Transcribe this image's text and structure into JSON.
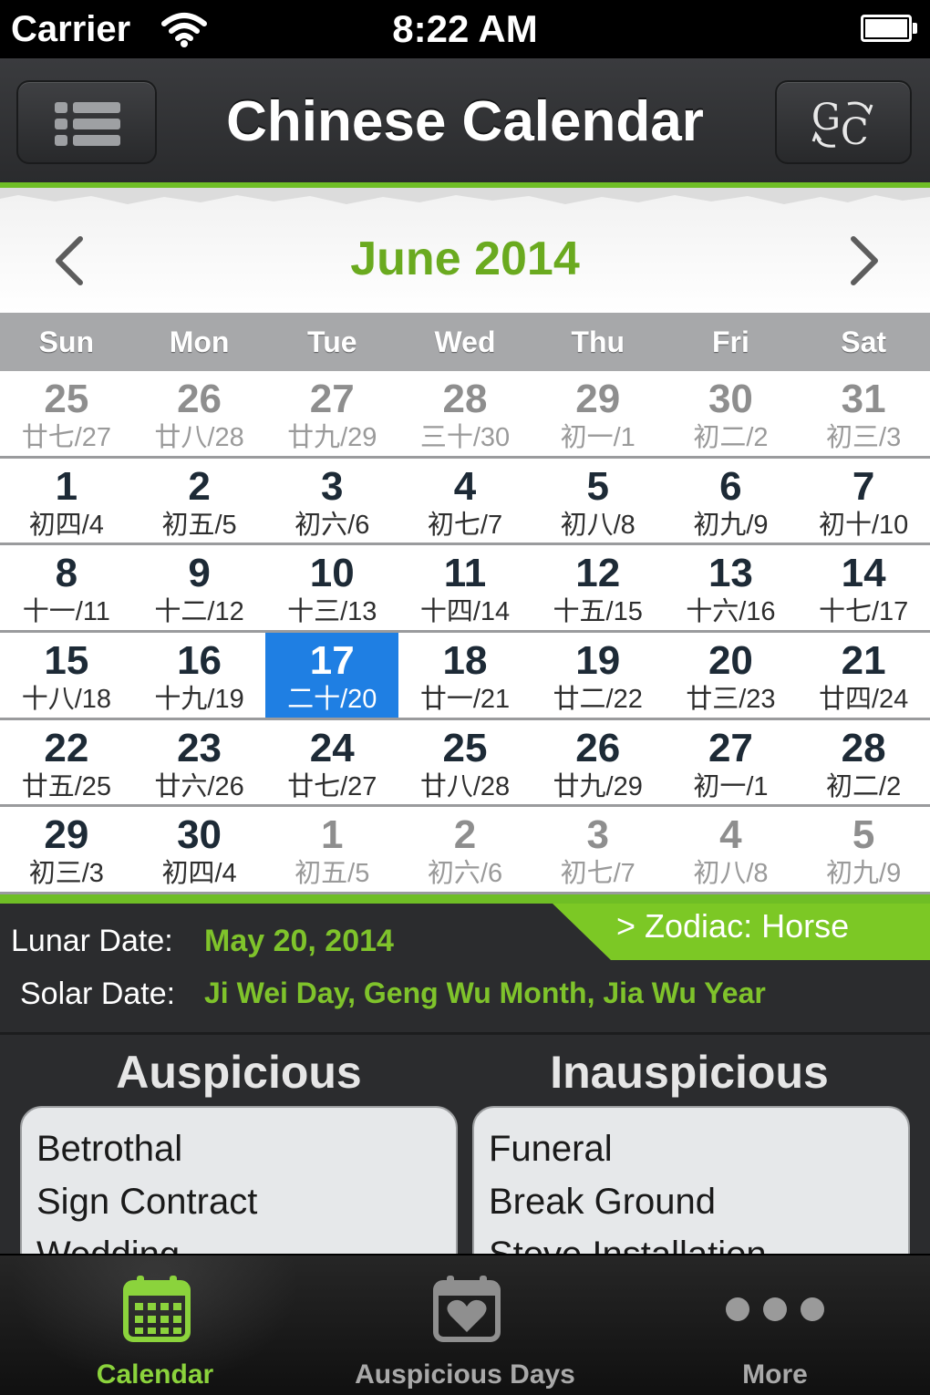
{
  "status_bar": {
    "carrier": "Carrier",
    "time": "8:22 AM"
  },
  "nav": {
    "title": "Chinese Calendar",
    "left_icon": "list-icon",
    "right_icon": "gc-convert-icon",
    "right_icon_letters": {
      "g": "G",
      "c": "C"
    }
  },
  "month": {
    "title": "June 2014",
    "color": "#6aaa1f"
  },
  "weekdays": [
    "Sun",
    "Mon",
    "Tue",
    "Wed",
    "Thu",
    "Fri",
    "Sat"
  ],
  "weeks": [
    [
      {
        "day": "25",
        "lunar": "廿七/27",
        "other": true
      },
      {
        "day": "26",
        "lunar": "廿八/28",
        "other": true
      },
      {
        "day": "27",
        "lunar": "廿九/29",
        "other": true
      },
      {
        "day": "28",
        "lunar": "三十/30",
        "other": true
      },
      {
        "day": "29",
        "lunar": "初一/1",
        "other": true
      },
      {
        "day": "30",
        "lunar": "初二/2",
        "other": true
      },
      {
        "day": "31",
        "lunar": "初三/3",
        "other": true
      }
    ],
    [
      {
        "day": "1",
        "lunar": "初四/4"
      },
      {
        "day": "2",
        "lunar": "初五/5"
      },
      {
        "day": "3",
        "lunar": "初六/6"
      },
      {
        "day": "4",
        "lunar": "初七/7"
      },
      {
        "day": "5",
        "lunar": "初八/8"
      },
      {
        "day": "6",
        "lunar": "初九/9"
      },
      {
        "day": "7",
        "lunar": "初十/10"
      }
    ],
    [
      {
        "day": "8",
        "lunar": "十一/11"
      },
      {
        "day": "9",
        "lunar": "十二/12"
      },
      {
        "day": "10",
        "lunar": "十三/13"
      },
      {
        "day": "11",
        "lunar": "十四/14"
      },
      {
        "day": "12",
        "lunar": "十五/15"
      },
      {
        "day": "13",
        "lunar": "十六/16"
      },
      {
        "day": "14",
        "lunar": "十七/17"
      }
    ],
    [
      {
        "day": "15",
        "lunar": "十八/18"
      },
      {
        "day": "16",
        "lunar": "十九/19"
      },
      {
        "day": "17",
        "lunar": "二十/20",
        "selected": true
      },
      {
        "day": "18",
        "lunar": "廿一/21"
      },
      {
        "day": "19",
        "lunar": "廿二/22"
      },
      {
        "day": "20",
        "lunar": "廿三/23"
      },
      {
        "day": "21",
        "lunar": "廿四/24"
      }
    ],
    [
      {
        "day": "22",
        "lunar": "廿五/25"
      },
      {
        "day": "23",
        "lunar": "廿六/26"
      },
      {
        "day": "24",
        "lunar": "廿七/27"
      },
      {
        "day": "25",
        "lunar": "廿八/28"
      },
      {
        "day": "26",
        "lunar": "廿九/29"
      },
      {
        "day": "27",
        "lunar": "初一/1"
      },
      {
        "day": "28",
        "lunar": "初二/2"
      }
    ],
    [
      {
        "day": "29",
        "lunar": "初三/3"
      },
      {
        "day": "30",
        "lunar": "初四/4"
      },
      {
        "day": "1",
        "lunar": "初五/5",
        "other": true
      },
      {
        "day": "2",
        "lunar": "初六/6",
        "other": true
      },
      {
        "day": "3",
        "lunar": "初七/7",
        "other": true
      },
      {
        "day": "4",
        "lunar": "初八/8",
        "other": true
      },
      {
        "day": "5",
        "lunar": "初九/9",
        "other": true
      }
    ]
  ],
  "info": {
    "lunar_label": "Lunar Date:",
    "lunar_value": "May 20, 2014",
    "solar_label": "Solar Date:",
    "solar_value": "Ji Wei Day, Geng Wu Month, Jia Wu Year",
    "zodiac": "> Zodiac: Horse"
  },
  "auspicious": {
    "heading": "Auspicious",
    "items": [
      "Betrothal",
      "Sign Contract",
      "Wedding"
    ]
  },
  "inauspicious": {
    "heading": "Inauspicious",
    "items": [
      "Funeral",
      "Break Ground",
      "Stove Installation"
    ]
  },
  "tabs": [
    {
      "label": "Calendar",
      "icon": "calendar-icon",
      "active": true
    },
    {
      "label": "Auspicious Days",
      "icon": "heart-calendar-icon",
      "active": false
    },
    {
      "label": "More",
      "icon": "more-icon",
      "active": false
    }
  ],
  "colors": {
    "accent_green": "#6fbe25",
    "selected_blue": "#1f7fe3",
    "active_tab": "#8bd33c"
  }
}
